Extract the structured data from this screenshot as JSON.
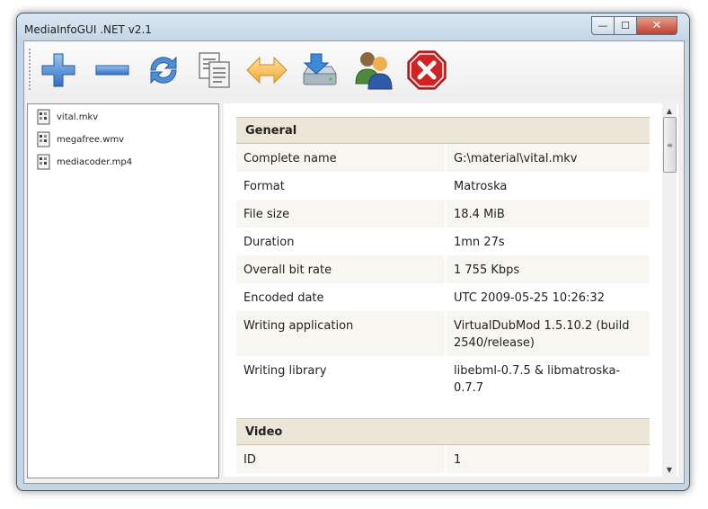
{
  "window": {
    "title": "MediaInfoGUI .NET v2.1"
  },
  "caption": {
    "minimize": "—",
    "maximize": "☐",
    "close": "✕"
  },
  "toolbar": {
    "buttons": [
      {
        "name": "add-icon"
      },
      {
        "name": "remove-icon"
      },
      {
        "name": "refresh-icon"
      },
      {
        "name": "copy-icon"
      },
      {
        "name": "compare-icon"
      },
      {
        "name": "export-icon"
      },
      {
        "name": "users-icon"
      },
      {
        "name": "stop-icon"
      }
    ]
  },
  "files": [
    {
      "label": "vital.mkv"
    },
    {
      "label": "megafree.wmv"
    },
    {
      "label": "mediacoder.mp4"
    }
  ],
  "info": {
    "general": {
      "header": "General",
      "rows": [
        {
          "key": "Complete name",
          "value": "G:\\material\\vital.mkv"
        },
        {
          "key": "Format",
          "value": "Matroska"
        },
        {
          "key": "File size",
          "value": "18.4 MiB"
        },
        {
          "key": "Duration",
          "value": "1mn 27s"
        },
        {
          "key": "Overall bit rate",
          "value": "1 755 Kbps"
        },
        {
          "key": "Encoded date",
          "value": "UTC 2009-05-25 10:26:32"
        },
        {
          "key": "Writing application",
          "value": "VirtualDubMod 1.5.10.2 (build 2540/release)"
        },
        {
          "key": "Writing library",
          "value": "libebml-0.7.5 & libmatroska-0.7.7"
        }
      ]
    },
    "video": {
      "header": "Video",
      "rows": [
        {
          "key": "ID",
          "value": "1"
        }
      ]
    }
  },
  "scrollbar": {
    "up": "▲",
    "down": "▼",
    "thumb": "≡"
  },
  "colors": {
    "section_header": "#ece6d8",
    "row_shaded": "#f8f6f0",
    "close_button": "#c0412c"
  }
}
